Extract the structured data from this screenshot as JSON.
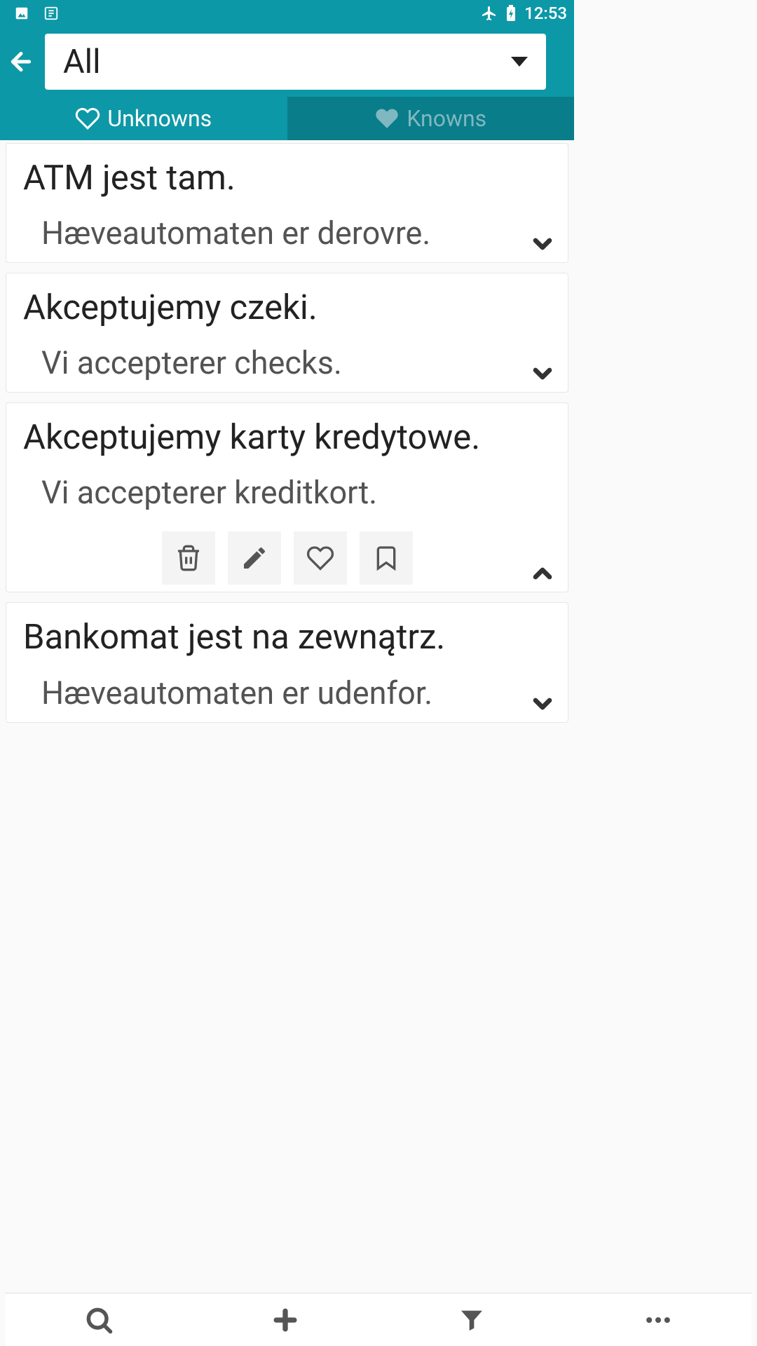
{
  "statusbar": {
    "time": "12:53"
  },
  "header": {
    "dropdown_selected": "All"
  },
  "tabs": {
    "unknowns": "Unknowns",
    "knowns": "Knowns"
  },
  "cards": [
    {
      "primary": "ATM jest tam.",
      "secondary": "Hæveautomaten er derovre."
    },
    {
      "primary": "Akceptujemy czeki.",
      "secondary": "Vi accepterer checks."
    },
    {
      "primary": "Akceptujemy karty kredytowe.",
      "secondary": "Vi accepterer kreditkort."
    },
    {
      "primary": "Bankomat jest na zewnątrz.",
      "secondary": "Hæveautomaten er udenfor."
    }
  ]
}
